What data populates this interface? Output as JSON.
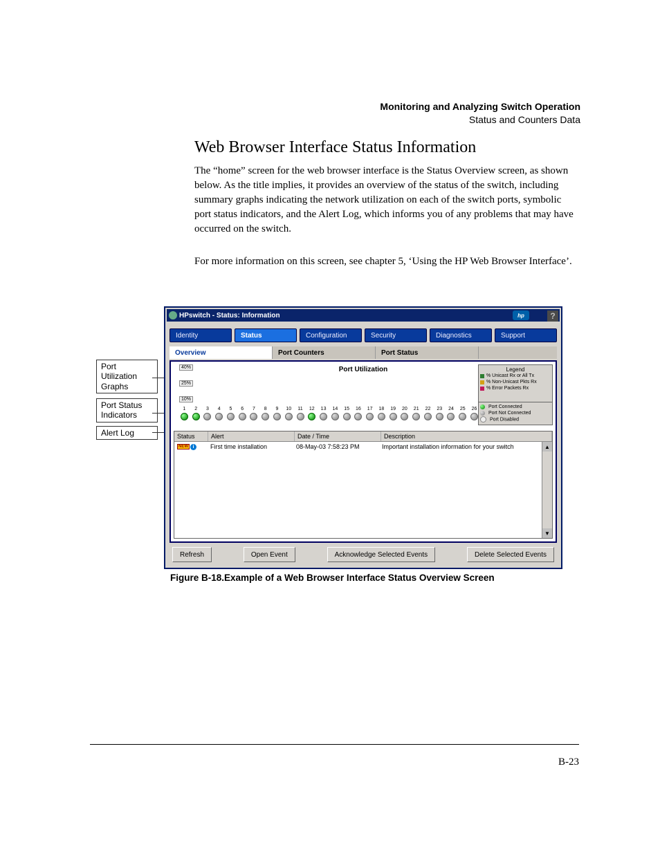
{
  "header": {
    "line1": "Monitoring and Analyzing Switch Operation",
    "line2": "Status and Counters Data"
  },
  "section_title": "Web Browser Interface Status Information",
  "para1": "The “home” screen for the web browser interface is the Status Overview screen, as shown below. As the title implies, it provides an overview of the status of the switch, including summary graphs indicating the network utili­zation on each of the switch ports, symbolic port status indicators, and the Alert Log, which informs you of any problems that may have occurred on the switch.",
  "para2": "For more information on this screen, see chapter 5, ‘Using the HP Web Browser Interface’.",
  "callouts": {
    "co1": "Port Utilization Graphs",
    "co2": "Port Status Indicators",
    "co3": "Alert Log"
  },
  "screenshot": {
    "window_title": "HPswitch - Status: Information",
    "hp_logo_text": "hp",
    "help_glyph": "?",
    "nav_tabs": [
      "Identity",
      "Status",
      "Configuration",
      "Security",
      "Diagnostics",
      "Support"
    ],
    "active_nav_index": 1,
    "sub_tabs": [
      "Overview",
      "Port Counters",
      "Port Status"
    ],
    "active_sub_index": 0,
    "port_util_title": "Port Utilization",
    "percent_marks": [
      "40%",
      "25%",
      "10%"
    ],
    "legend": {
      "title": "Legend",
      "items": [
        {
          "color": "#2e7d32",
          "label": "% Unicast Rx or All Tx"
        },
        {
          "color": "#d4a017",
          "label": "% Non-Unicast Pkts Rx"
        },
        {
          "color": "#c2185b",
          "label": "% Error Packets Rx"
        }
      ]
    },
    "port_legend": [
      {
        "led": "on",
        "label": "Port Connected"
      },
      {
        "led": "off",
        "label": "Port Not Connected"
      },
      {
        "led": "dis",
        "label": "Port Disabled"
      }
    ],
    "ports": [
      {
        "n": 1,
        "on": true
      },
      {
        "n": 2,
        "on": true
      },
      {
        "n": 3,
        "on": false
      },
      {
        "n": 4,
        "on": false
      },
      {
        "n": 5,
        "on": false
      },
      {
        "n": 6,
        "on": false
      },
      {
        "n": 7,
        "on": false
      },
      {
        "n": 8,
        "on": false
      },
      {
        "n": 9,
        "on": false
      },
      {
        "n": 10,
        "on": false
      },
      {
        "n": 11,
        "on": false
      },
      {
        "n": 12,
        "on": true
      },
      {
        "n": 13,
        "on": false
      },
      {
        "n": 14,
        "on": false
      },
      {
        "n": 15,
        "on": false
      },
      {
        "n": 16,
        "on": false
      },
      {
        "n": 17,
        "on": false
      },
      {
        "n": 18,
        "on": false
      },
      {
        "n": 19,
        "on": false
      },
      {
        "n": 20,
        "on": false
      },
      {
        "n": 21,
        "on": false
      },
      {
        "n": 22,
        "on": false
      },
      {
        "n": 23,
        "on": false
      },
      {
        "n": 24,
        "on": false
      },
      {
        "n": 25,
        "on": false
      },
      {
        "n": 26,
        "on": false
      }
    ],
    "log_headers": [
      "Status",
      "Alert",
      "Date / Time",
      "Description"
    ],
    "log_row": {
      "new_text": "NEW",
      "info_glyph": "i",
      "alert": "First time installation",
      "datetime": "08-May-03 7:58:23 PM",
      "description": "Important installation information for your switch"
    },
    "buttons": {
      "refresh": "Refresh",
      "open": "Open Event",
      "ack": "Acknowledge Selected Events",
      "del": "Delete Selected Events"
    }
  },
  "caption": "Figure B-18.Example of a Web Browser Interface Status Overview Screen",
  "page_number": "B-23"
}
